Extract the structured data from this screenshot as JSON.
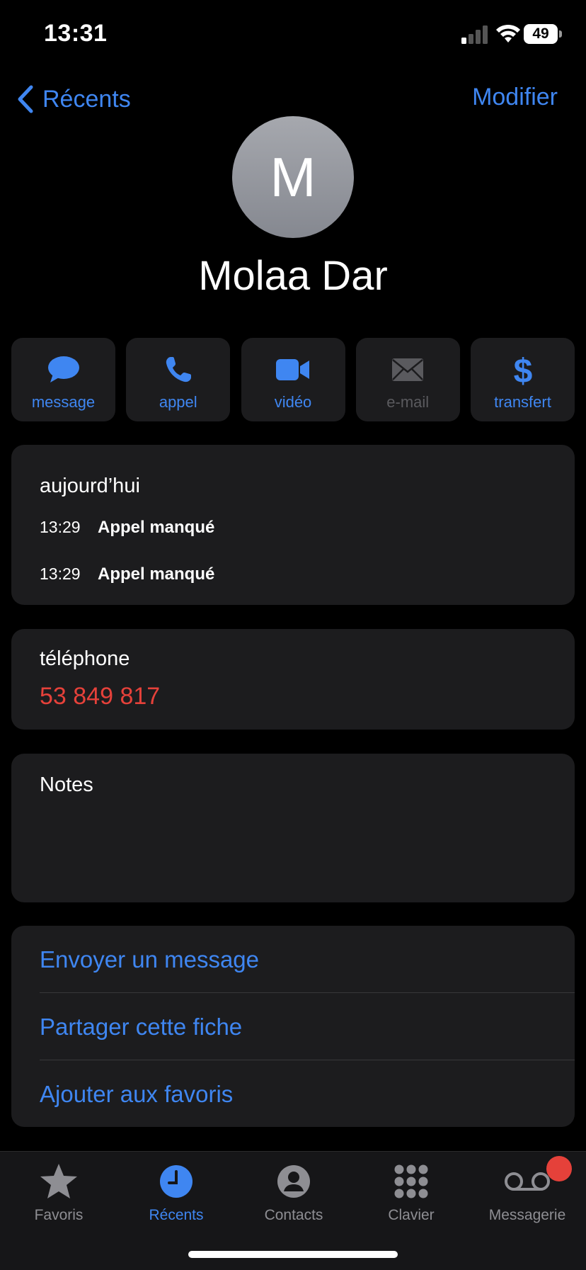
{
  "status_bar": {
    "time": "13:31",
    "battery": "49"
  },
  "nav": {
    "back_label": "Récents",
    "edit_label": "Modifier"
  },
  "contact": {
    "initial": "M",
    "name": "Molaa Dar"
  },
  "actions": [
    {
      "label": "message",
      "icon": "message-bubble-icon",
      "enabled": true
    },
    {
      "label": "appel",
      "icon": "phone-icon",
      "enabled": true
    },
    {
      "label": "vidéo",
      "icon": "video-camera-icon",
      "enabled": true
    },
    {
      "label": "e-mail",
      "icon": "envelope-icon",
      "enabled": false
    },
    {
      "label": "transfert",
      "icon": "dollar-icon",
      "enabled": true
    }
  ],
  "history": {
    "title": "aujourd’hui",
    "entries": [
      {
        "time": "13:29",
        "text": "Appel manqué"
      },
      {
        "time": "13:29",
        "text": "Appel manqué"
      }
    ]
  },
  "phone": {
    "label": "téléphone",
    "number": "53 849 817"
  },
  "notes": {
    "label": "Notes"
  },
  "links": [
    {
      "label": "Envoyer un message"
    },
    {
      "label": "Partager cette fiche"
    },
    {
      "label": "Ajouter aux favoris"
    }
  ],
  "tabbar": [
    {
      "label": "Favoris",
      "icon": "star-icon",
      "active": false
    },
    {
      "label": "Récents",
      "icon": "clock-icon",
      "active": true
    },
    {
      "label": "Contacts",
      "icon": "person-circle-icon",
      "active": false
    },
    {
      "label": "Clavier",
      "icon": "keypad-icon",
      "active": false
    },
    {
      "label": "Messagerie",
      "icon": "voicemail-icon",
      "active": false
    }
  ],
  "colors": {
    "accent": "#3f86f1",
    "danger": "#e5413a",
    "card": "#1c1c1e"
  }
}
